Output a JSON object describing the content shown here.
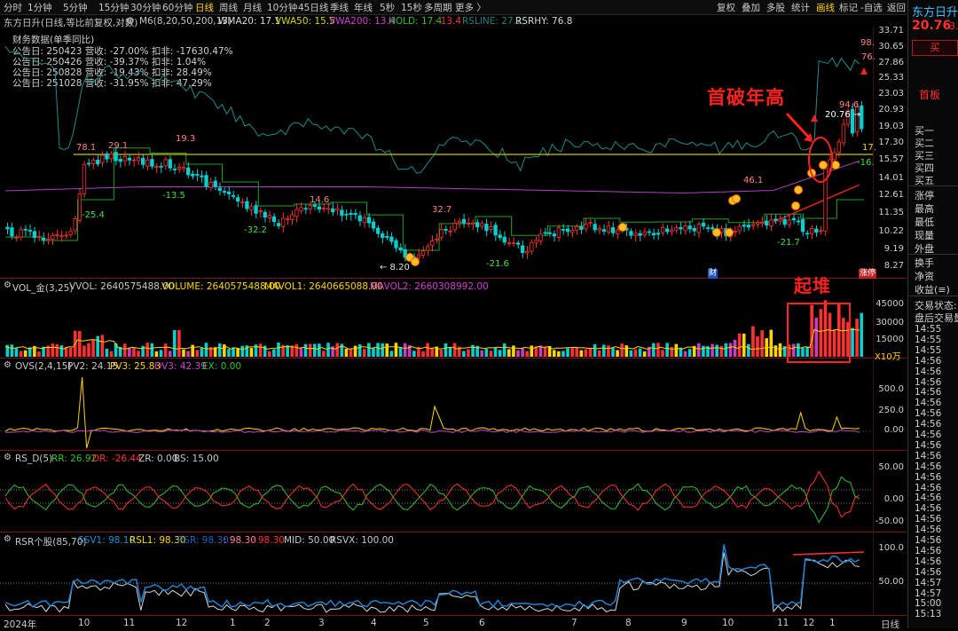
{
  "toolbar": {
    "timeframes": [
      "分时",
      "1分钟",
      "5分钟",
      "15分钟",
      "30分钟",
      "60分钟",
      "日线",
      "周线",
      "月线",
      "10分钟",
      "45日线",
      "季线",
      "年线",
      "5秒",
      "15秒",
      "多周期",
      "更多 〉"
    ],
    "active_timeframe": "日线",
    "right_buttons": [
      "复权",
      "叠加",
      "多股",
      "统计",
      "画线",
      "标记",
      "-自选",
      "返回"
    ],
    "active_right": "画线"
  },
  "main_header": {
    "stock_info": "东方日升(日线,等比前复权,对数)",
    "items": [
      {
        "text": "M6(8,20,50,200,13)",
        "color": "#c8c8c8"
      },
      {
        "text": "WMA20: 17.1",
        "color": "#d8d8d8"
      },
      {
        "text": "VWA50: 15.5",
        "color": "#d8d800"
      },
      {
        "text": "VWA200: 13.4",
        "color": "#d040d0"
      },
      {
        "text": "HOLD: 17.4",
        "color": "#30c030"
      },
      {
        "text": "· 13.4",
        "color": "#ff3030"
      },
      {
        "text": "RSLINE: 27.2",
        "color": "#208080"
      },
      {
        "text": "RSRHY: 76.8",
        "color": "#d8d8d8"
      }
    ]
  },
  "financial": {
    "title": "财务数据(单季同比)",
    "rows": [
      "公告日: 250423  营收: -27.00%  扣非: -17630.47%",
      "公告日: 250426  营收: -39.37%  扣非: 1.04%",
      "公告日: 250828  营收: -19.43%  扣非: 28.49%",
      "公告日: 251028  营收: -31.95%  扣非: 47.29%"
    ]
  },
  "annotations": {
    "first_break": "首破年高",
    "pile_up": "起堆",
    "cai": "财",
    "zhangting": "涨停"
  },
  "price_axis": [
    "33.71",
    "30.65",
    "27.86",
    "25.33",
    "23.03",
    "20.93",
    "19.03",
    "17.30",
    "15.57",
    "14.01",
    "12.61",
    "11.35",
    "10.22",
    "9.19",
    "8.27"
  ],
  "price_labels": [
    {
      "text": "78.1",
      "color": "#ff8080"
    },
    {
      "text": "29.1",
      "color": "#ff8080"
    },
    {
      "text": "19.3",
      "color": "#ff8080"
    },
    {
      "text": "-25.4",
      "color": "#40e040"
    },
    {
      "text": "-13.5",
      "color": "#40e040"
    },
    {
      "text": "-32.2",
      "color": "#40e040"
    },
    {
      "text": "14.6",
      "color": "#ff8080"
    },
    {
      "text": "← 8.20",
      "color": "#e0e0e0"
    },
    {
      "text": "32.7",
      "color": "#ff8080"
    },
    {
      "text": "-21.6",
      "color": "#40e040"
    },
    {
      "text": "46.1",
      "color": "#ff8080"
    },
    {
      "text": "-21.7",
      "color": "#40e040"
    },
    {
      "text": "94.6",
      "color": "#ff8080"
    },
    {
      "text": "20.76 →",
      "color": "#ffffff"
    },
    {
      "text": "98.",
      "color": "#ff8080"
    },
    {
      "text": "76.",
      "color": "#ff8080"
    },
    {
      "text": "17.",
      "color": "#ffd400"
    },
    {
      "text": "-16.",
      "color": "#40e040"
    }
  ],
  "vol": {
    "header": [
      {
        "text": "VOL_金(3,25)",
        "color": "#c8c8c8"
      },
      {
        "text": "VVOL: 2640575488.00",
        "color": "#c8c8c8"
      },
      {
        "text": "VOLUME: 2640575488.00",
        "color": "#ffd400"
      },
      {
        "text": "MAVOL1: 2640665088.00",
        "color": "#ffd400"
      },
      {
        "text": "MAVOL2: 2660308992.00",
        "color": "#d040d0"
      }
    ],
    "axis": [
      "45000",
      "30000",
      "15000"
    ],
    "unit": "X10万"
  },
  "ovs": {
    "header": [
      {
        "text": "OVS(2,4,15)",
        "color": "#c8c8c8"
      },
      {
        "text": "PV2: 24.15",
        "color": "#c8c8c8"
      },
      {
        "text": "PV3: 25.83",
        "color": "#ffd400"
      },
      {
        "text": "OV3: 42.39",
        "color": "#d040d0"
      },
      {
        "text": "EX: 0.00",
        "color": "#30c030"
      }
    ],
    "axis": [
      "500.0",
      "250.0",
      "0.00"
    ]
  },
  "rsd": {
    "header": [
      {
        "text": "RS_D(5)",
        "color": "#c8c8c8"
      },
      {
        "text": "RR: 26.92",
        "color": "#30c030"
      },
      {
        "text": "DR: -26.44",
        "color": "#ff3030"
      },
      {
        "text": "ZR: 0.00",
        "color": "#c8c8c8"
      },
      {
        "text": "BS: 15.00",
        "color": "#c8c8c8"
      }
    ],
    "axis": [
      "50.00",
      "0.00",
      "-50.00"
    ]
  },
  "rsr": {
    "header": [
      {
        "text": "RSR个股(85,70)",
        "color": "#c8c8c8"
      },
      {
        "text": "SSV1: 98.10",
        "color": "#2090d0"
      },
      {
        "text": "RSL1: 98.30",
        "color": "#ffd400"
      },
      {
        "text": "RSR: 98.30",
        "color": "#2060c0"
      },
      {
        "text": ": 98.30",
        "color": "#ff80a0"
      },
      {
        "text": ": 98.30",
        "color": "#ff3030"
      },
      {
        "text": "MID: 50.00",
        "color": "#c8c8c8"
      },
      {
        "text": "RSVX: 100.00",
        "color": "#c8c8c8"
      }
    ],
    "axis": [
      "100.0",
      "50.00"
    ]
  },
  "x_axis": [
    "2024年",
    "10",
    "11",
    "12",
    "1",
    "2",
    "3",
    "4",
    "5",
    "6",
    "7",
    "8",
    "9",
    "10",
    "11",
    "12",
    "1",
    "日线"
  ],
  "right_panel": {
    "name": "东方日升",
    "price": "20.76",
    "change": "3.",
    "buy_label": "买",
    "board": "首板",
    "book": [
      "买一",
      "买二",
      "买三",
      "买四",
      "买五"
    ],
    "fields": [
      "涨停",
      "最高",
      "最低",
      "现量",
      "外盘"
    ],
    "fields2": [
      "换手",
      "净资",
      "收益(≡)"
    ],
    "status": [
      "交易状态:",
      "盘后交易量"
    ],
    "times": [
      "14:55",
      "14:55",
      "14:55",
      "14:56",
      "14:56",
      "14:56",
      "14:56",
      "14:56",
      "14:56",
      "14:56",
      "14:56",
      "14:56",
      "14:56",
      "14:56",
      "14:56",
      "14:56",
      "14:56",
      "14:56",
      "14:56",
      "14:56",
      "14:56",
      "14:56",
      "14:56",
      "14:56",
      "14:57",
      "14:57",
      "15:00",
      "15:13"
    ]
  },
  "colors": {
    "up": "#ff3030",
    "down": "#00d0d0",
    "hline": "#c8c800",
    "accent": "#e02020",
    "panel_sep": "#7a1515"
  }
}
